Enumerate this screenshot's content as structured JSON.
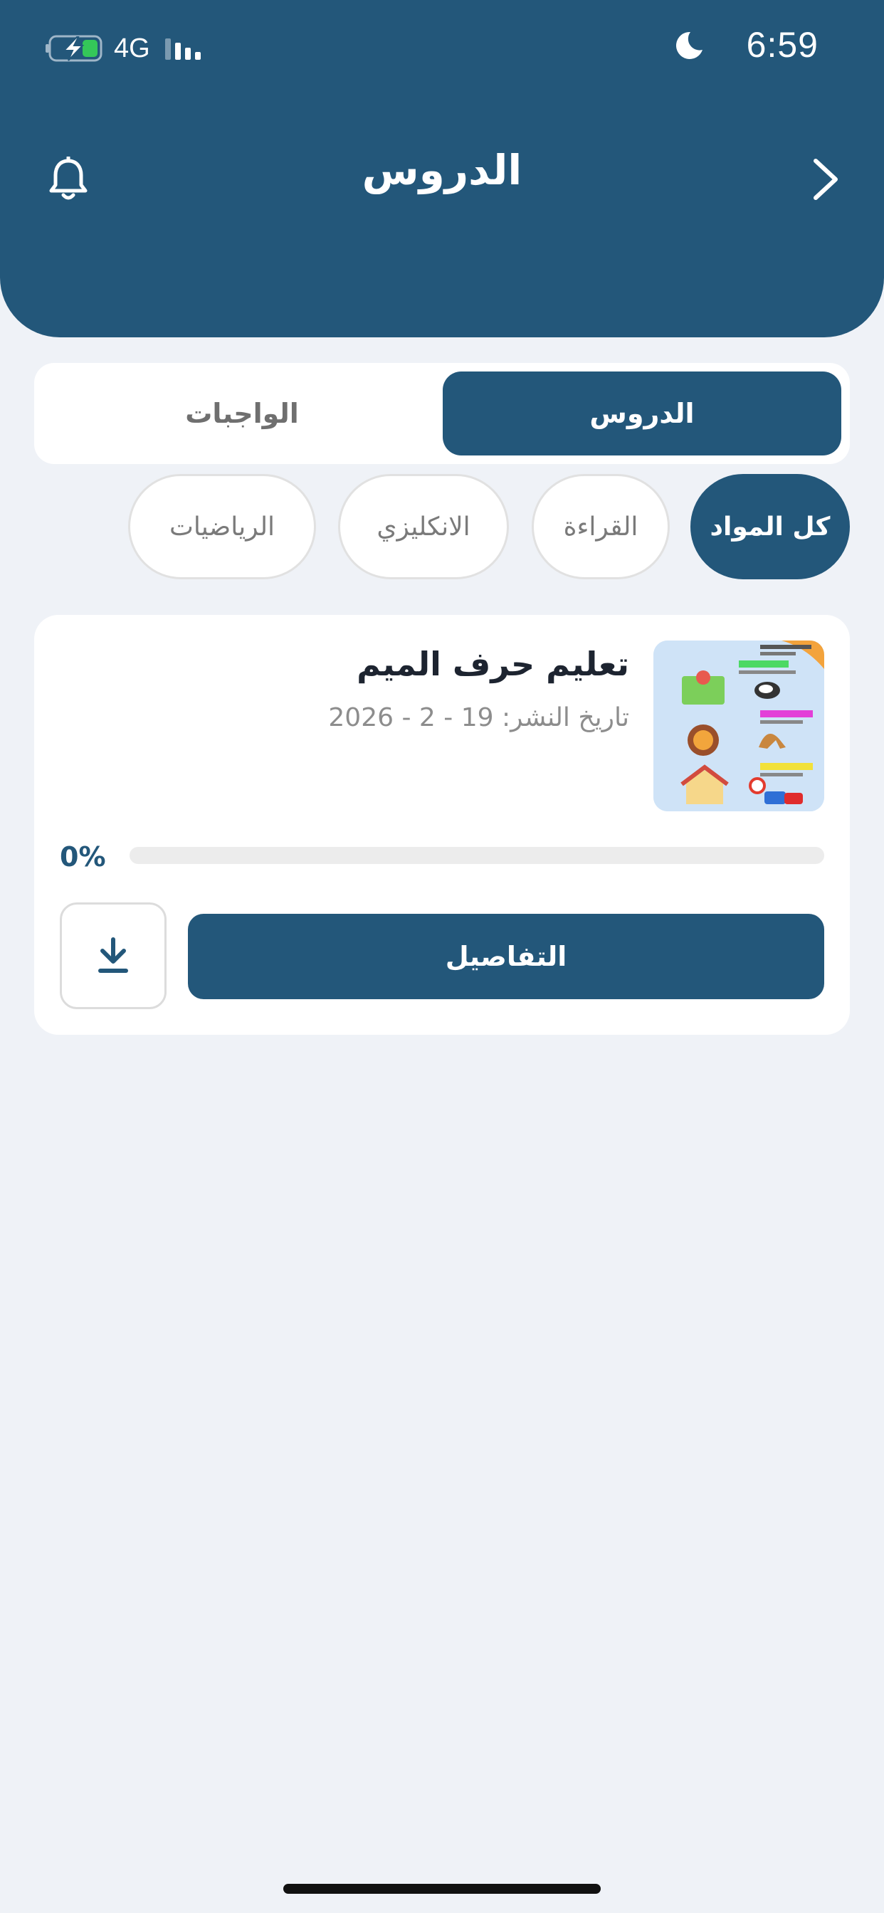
{
  "status_bar": {
    "time": "6:59",
    "network": "4G",
    "icons": [
      "battery-charging-icon",
      "signal-icon",
      "moon-icon"
    ]
  },
  "header": {
    "title": "الدروس",
    "left_icon": "bell-icon",
    "right_icon": "chevron-right-icon"
  },
  "segments": {
    "active": "الدروس",
    "inactive": "الواجبات"
  },
  "filters": {
    "items": [
      "كل المواد",
      "القراءة",
      "الانكليزي",
      "الرياضيات"
    ],
    "selected": "كل المواد"
  },
  "lesson": {
    "title": "تعليم حرف الميم",
    "date": "تاريخ النشر: 19 - 2 - 2026",
    "progress_label": "0%",
    "progress": 0,
    "details_label": "التفاصيل",
    "download_icon": "download-icon"
  },
  "colors": {
    "primary": "#23577a",
    "background": "#eff2f7",
    "card": "#ffffff"
  }
}
